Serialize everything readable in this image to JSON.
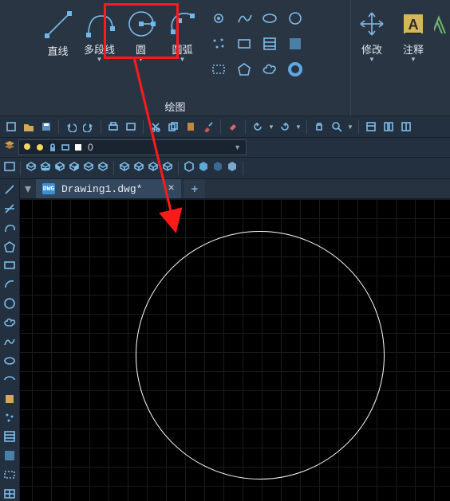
{
  "ribbon": {
    "tools": {
      "line": "直线",
      "polyline": "多段线",
      "circle": "圆",
      "arc": "圆弧",
      "modify": "修改",
      "annotate": "注释"
    },
    "group_label": "绘图"
  },
  "layer": {
    "current": "0"
  },
  "tab": {
    "filename": "Drawing1.dwg*",
    "icon_text": "DWG"
  },
  "icons": {
    "close": "×",
    "plus": "+",
    "dropdown": "▾"
  }
}
